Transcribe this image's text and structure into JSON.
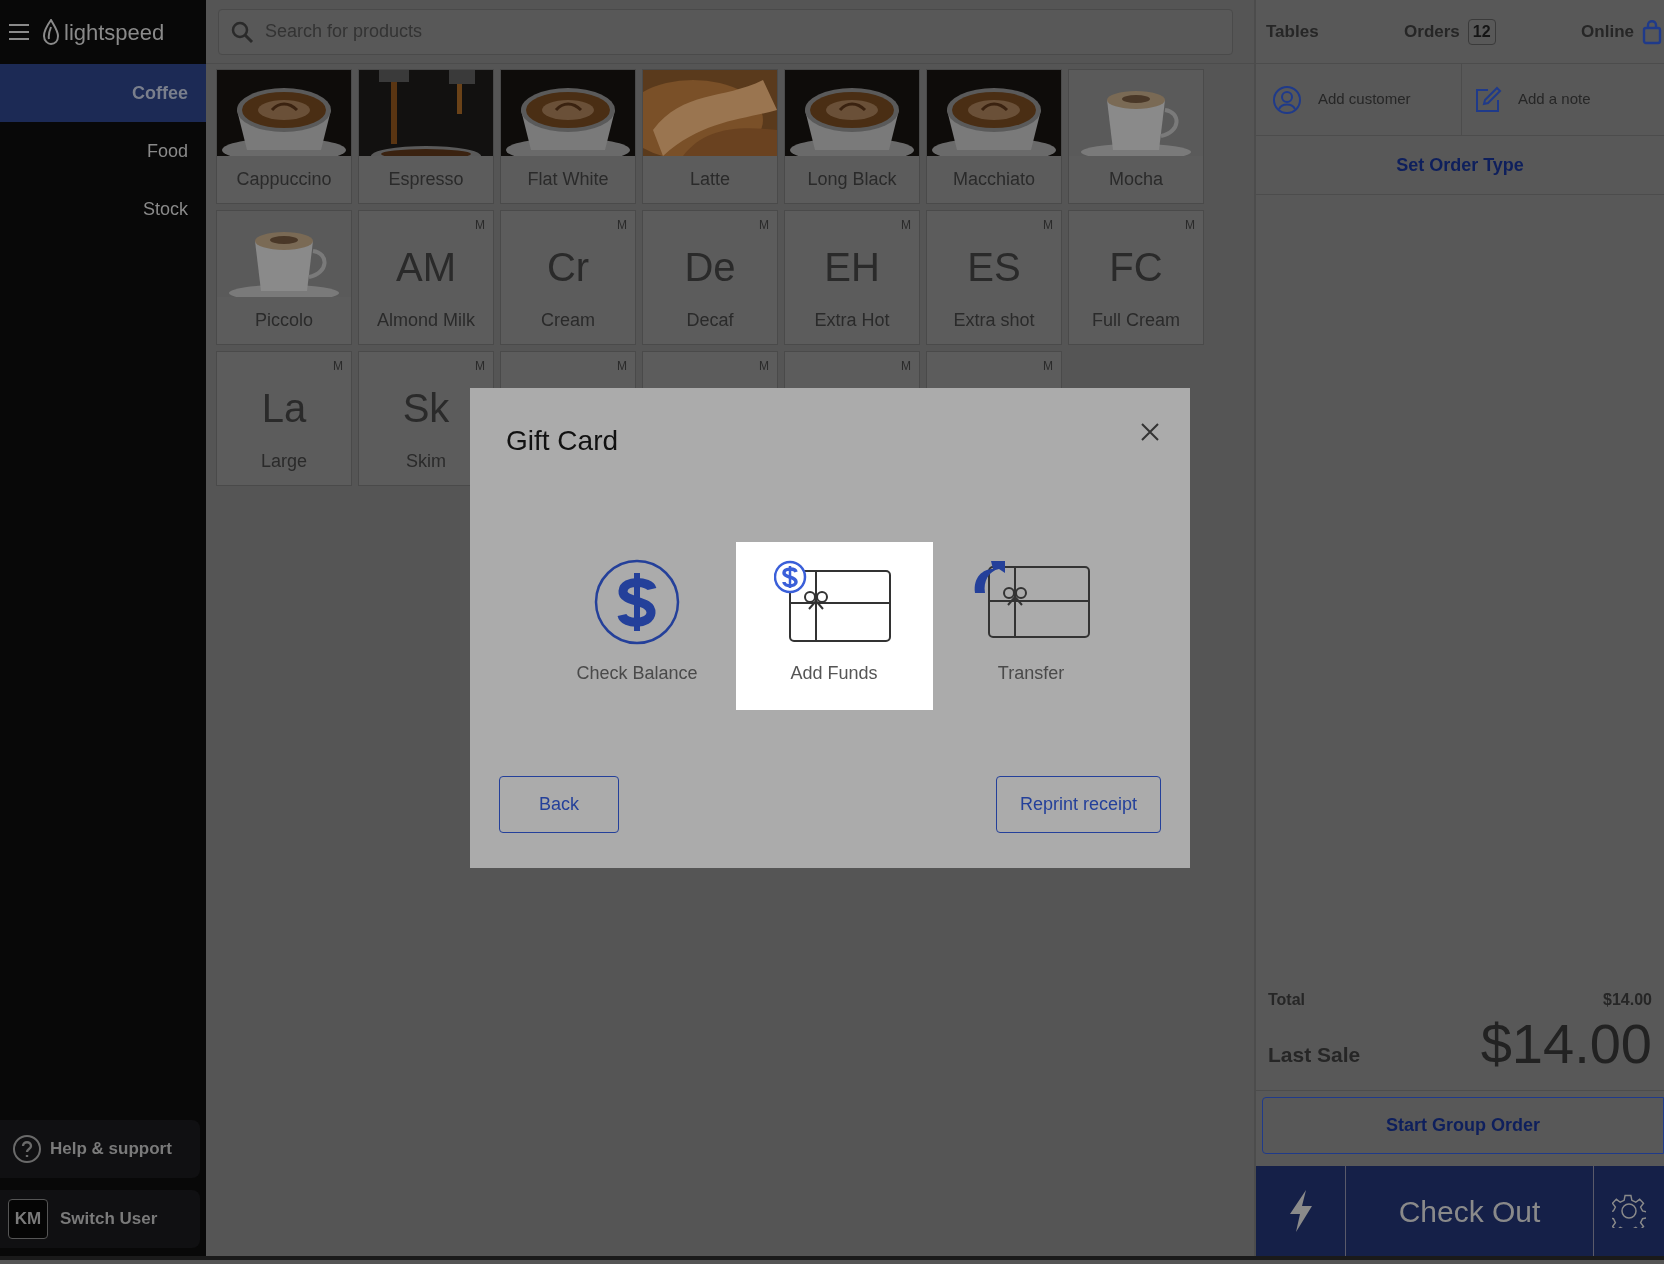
{
  "sidebar": {
    "brand": "lightspeed",
    "items": [
      {
        "label": "Coffee",
        "selected": true
      },
      {
        "label": "Food",
        "selected": false
      },
      {
        "label": "Stock",
        "selected": false
      }
    ],
    "help": "Help & support",
    "user_initials": "KM",
    "switch_user": "Switch User"
  },
  "search": {
    "placeholder": "Search for products"
  },
  "products": [
    {
      "label": "Cappuccino"
    },
    {
      "label": "Espresso"
    },
    {
      "label": "Flat White"
    },
    {
      "label": "Latte"
    },
    {
      "label": "Long Black"
    },
    {
      "label": "Macchiato"
    },
    {
      "label": "Mocha"
    },
    {
      "label": "Piccolo"
    },
    {
      "kind": "letter",
      "abbr": "AM",
      "label": "Almond Milk",
      "badge": "M"
    },
    {
      "kind": "letter",
      "abbr": "Cr",
      "label": "Cream",
      "badge": "M"
    },
    {
      "kind": "letter",
      "abbr": "De",
      "label": "Decaf",
      "badge": "M"
    },
    {
      "kind": "letter",
      "abbr": "EH",
      "label": "Extra Hot",
      "badge": "M"
    },
    {
      "kind": "letter",
      "abbr": "ES",
      "label": "Extra shot",
      "badge": "M"
    },
    {
      "kind": "letter",
      "abbr": "FC",
      "label": "Full Cream",
      "badge": "M"
    },
    {
      "kind": "letter",
      "abbr": "La",
      "label": "Large",
      "badge": "M"
    },
    {
      "kind": "letter",
      "abbr": "Sk",
      "label": "Skim",
      "badge": "M"
    },
    {
      "kind": "letter",
      "badge": "M"
    },
    {
      "kind": "letter",
      "badge": "M"
    },
    {
      "kind": "letter",
      "badge": "M"
    },
    {
      "kind": "letter",
      "badge": "M"
    }
  ],
  "order_panel": {
    "tabs": [
      {
        "label": "Tables"
      },
      {
        "label": "Orders",
        "count": "12"
      },
      {
        "label": "Online"
      }
    ],
    "add_customer": "Add customer",
    "add_note": "Add a note",
    "order_type": "Set Order Type",
    "total_label": "Total",
    "total_value": "$14.00",
    "last_sale_label": "Last Sale",
    "last_sale_value": "$14.00",
    "group_order": "Start Group Order",
    "checkout": "Check Out"
  },
  "dialog": {
    "title": "Gift Card",
    "options": [
      {
        "kind": "balance",
        "label": "Check Balance",
        "selected": false
      },
      {
        "kind": "add",
        "label": "Add Funds",
        "selected": true
      },
      {
        "kind": "transfer",
        "label": "Transfer",
        "selected": false
      }
    ],
    "back": "Back",
    "reprint": "Reprint receipt"
  }
}
